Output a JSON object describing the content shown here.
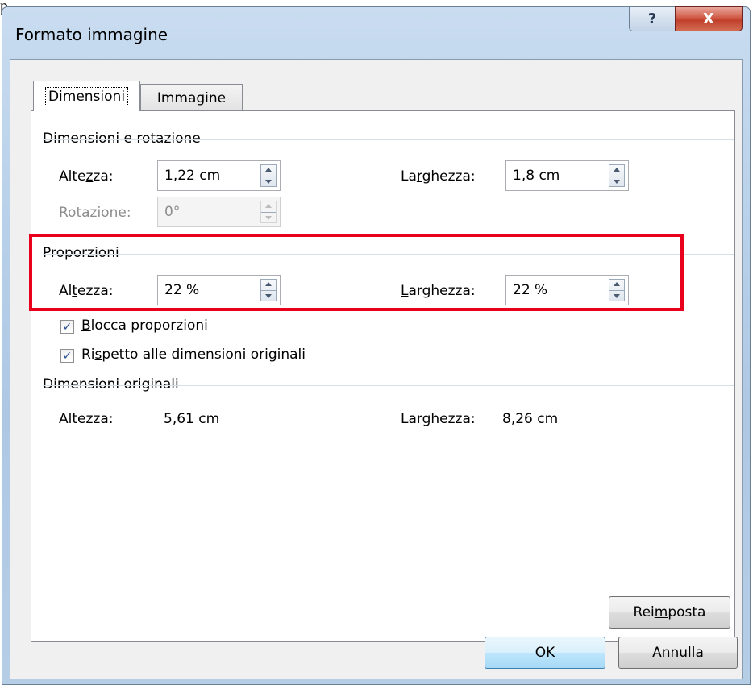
{
  "top_fragment": "p",
  "window": {
    "title": "Formato immagine",
    "help_glyph": "?",
    "close_glyph": "X"
  },
  "tabs": [
    {
      "label": "Dimensioni",
      "active": true
    },
    {
      "label": "Immagine",
      "active": false
    }
  ],
  "size_rotation": {
    "title": "Dimensioni e rotazione",
    "height_label": "Altezza:",
    "height_value": "1,22 cm",
    "width_label": "Larghezza:",
    "width_value": "1,8 cm",
    "rotation_label": "Rotazione:",
    "rotation_value": "0°"
  },
  "scale": {
    "title": "Proporzioni",
    "height_label": "Altezza:",
    "height_value": "22 %",
    "width_label": "Larghezza:",
    "width_value": "22 %",
    "lock_aspect_label": "Blocca proporzioni",
    "lock_aspect_checked": true,
    "relative_original_label": "Rispetto alle dimensioni originali",
    "relative_original_checked": true
  },
  "original_size": {
    "title": "Dimensioni originali",
    "height_label": "Altezza:",
    "height_value": "5,61 cm",
    "width_label": "Larghezza:",
    "width_value": "8,26 cm"
  },
  "buttons": {
    "reset": "Reimposta",
    "ok": "OK",
    "cancel": "Annulla"
  },
  "colors": {
    "highlight": "#e8001c",
    "close_button": "#c03f2b"
  }
}
